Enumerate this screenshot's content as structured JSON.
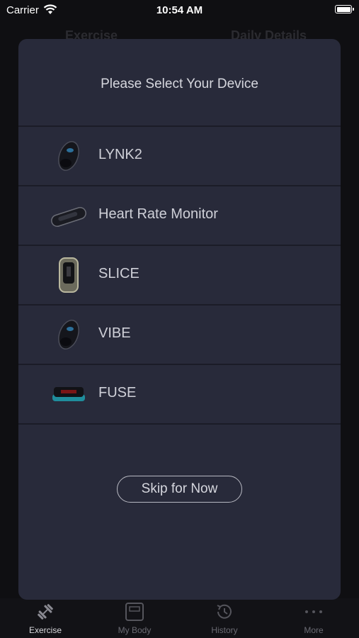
{
  "status_bar": {
    "carrier": "Carrier",
    "time": "10:54 AM"
  },
  "background": {
    "tabs": [
      "Exercise",
      "Daily Details"
    ]
  },
  "modal": {
    "title": "Please Select Your Device",
    "devices": [
      {
        "label": "LYNK2",
        "icon": "lynk2-device-icon"
      },
      {
        "label": "Heart Rate Monitor",
        "icon": "heart-rate-monitor-icon"
      },
      {
        "label": "SLICE",
        "icon": "slice-device-icon"
      },
      {
        "label": "VIBE",
        "icon": "vibe-device-icon"
      },
      {
        "label": "FUSE",
        "icon": "fuse-device-icon"
      }
    ],
    "skip_label": "Skip for Now"
  },
  "tabbar": {
    "items": [
      {
        "label": "Exercise",
        "icon": "dumbbell-icon",
        "active": true
      },
      {
        "label": "My Body",
        "icon": "scale-icon",
        "active": false
      },
      {
        "label": "History",
        "icon": "history-clock-icon",
        "active": false
      },
      {
        "label": "More",
        "icon": "more-dots-icon",
        "active": false
      }
    ]
  }
}
